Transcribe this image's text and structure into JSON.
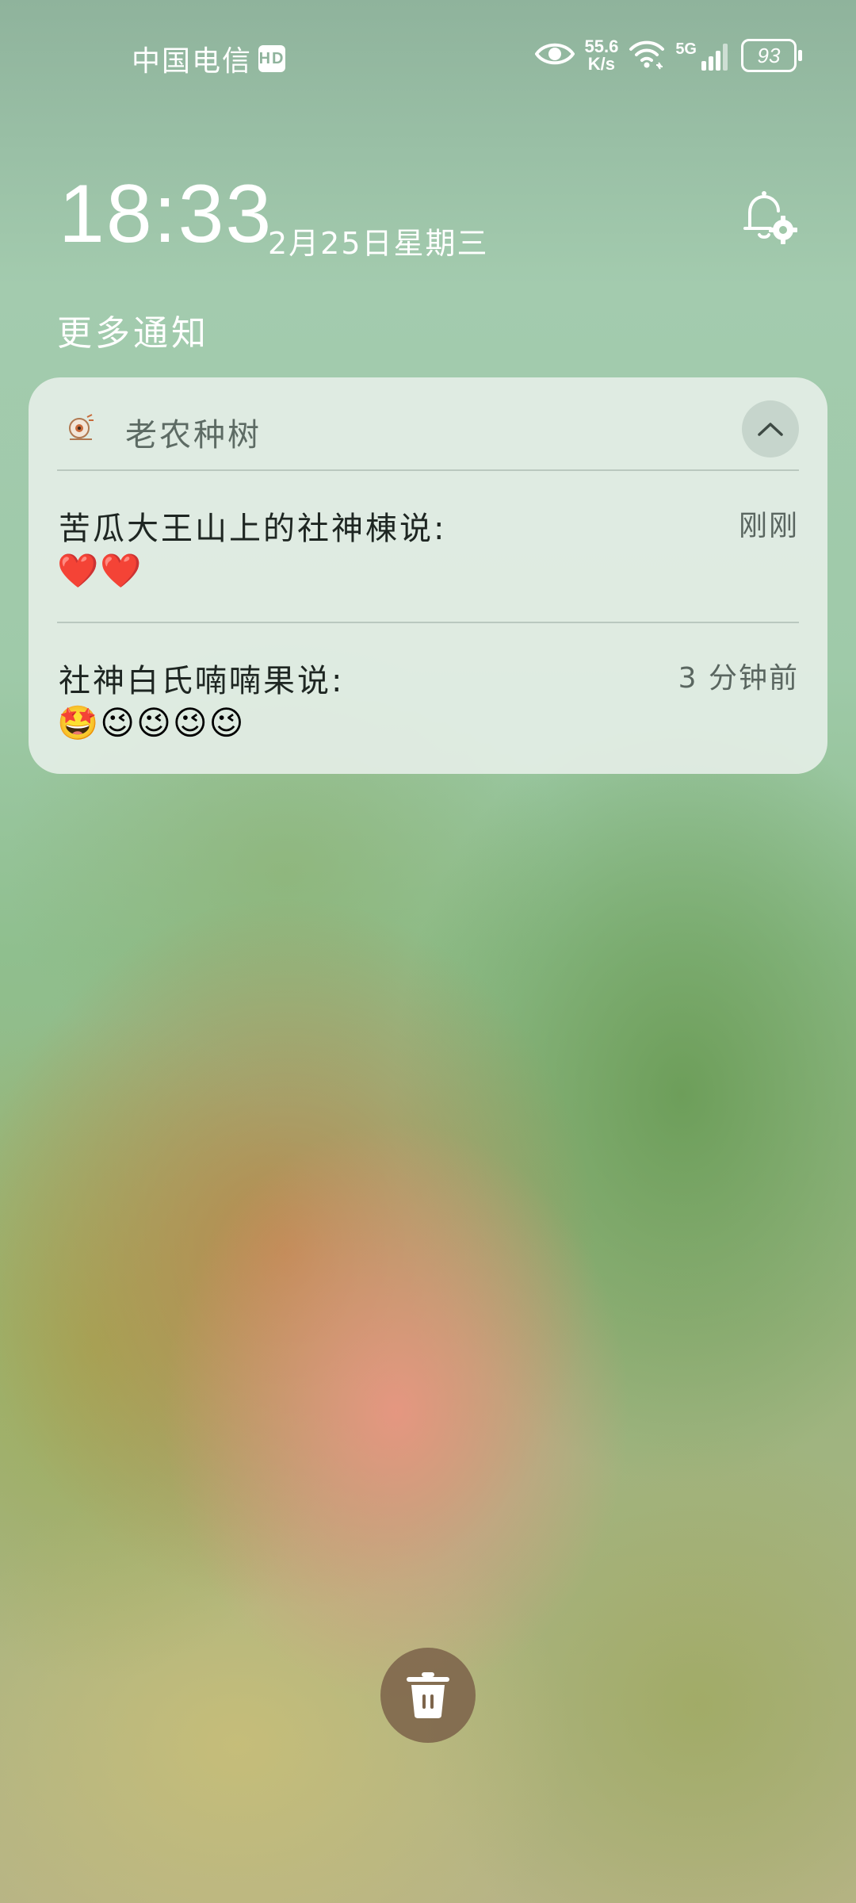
{
  "status_bar": {
    "carrier": "中国电信",
    "hd_badge": "HD",
    "speed_value": "55.6",
    "speed_unit": "K/s",
    "network": "5G",
    "battery": "93",
    "icons": [
      "eye-icon",
      "wifi-icon",
      "signal-icon",
      "battery-icon"
    ]
  },
  "lockscreen": {
    "time": "18:33",
    "date": "2月25日星期三",
    "more_notifications": "更多通知"
  },
  "notification_group": {
    "app_name": "老农种树",
    "messages": [
      {
        "title": "苦瓜大王山上的社神棟说:",
        "time": "刚刚",
        "body": "❤️❤️"
      },
      {
        "title": "社神白氏喃喃果说:",
        "time": "3 分钟前",
        "body": "🤩😉😉😉😉"
      }
    ]
  },
  "colors": {
    "card_bg": "#e4eee6",
    "trash_bg": "#7d644b",
    "text_dark": "#1e2622",
    "text_muted": "#5a6660"
  }
}
